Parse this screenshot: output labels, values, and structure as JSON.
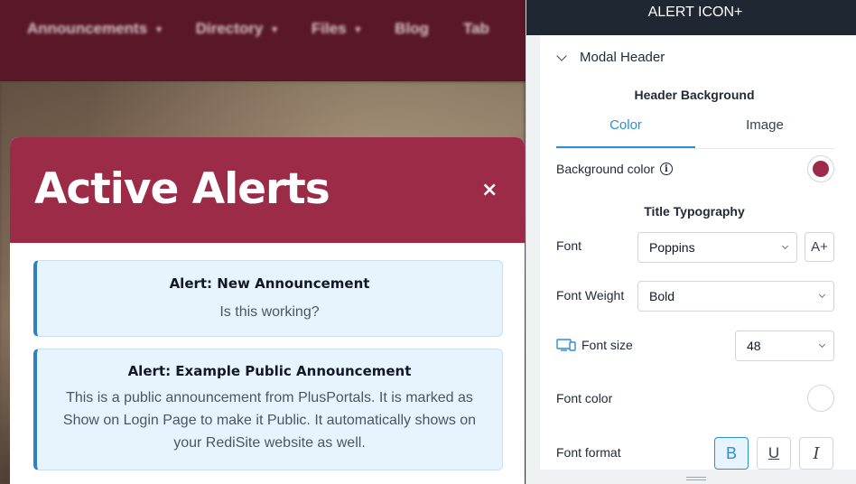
{
  "site": {
    "nav": [
      "Announcements",
      "Directory",
      "Files",
      "Blog",
      "Tab"
    ],
    "nav_has_caret": [
      true,
      true,
      true,
      false,
      false
    ]
  },
  "modal": {
    "title": "Active Alerts",
    "close_symbol": "×",
    "header_color": "#9b2b47",
    "alerts": [
      {
        "title": "Alert: New Announcement",
        "body": "Is this working?"
      },
      {
        "title": "Alert: Example Public Announcement",
        "body": "This is a public announcement from PlusPortals. It is marked as Show on Login Page to make it Public. It automatically shows on your RediSite website as well."
      }
    ]
  },
  "panel": {
    "top_title": "ALERT ICON+",
    "section": "Modal Header",
    "header_background_title": "Header Background",
    "tabs": [
      {
        "label": "Color",
        "active": true
      },
      {
        "label": "Image",
        "active": false
      }
    ],
    "background_color_label": "Background color",
    "background_color_value": "#9b2b47",
    "title_typography_title": "Title Typography",
    "font_label": "Font",
    "font_value": "Poppins",
    "font_button_label": "A+",
    "font_weight_label": "Font Weight",
    "font_weight_value": "Bold",
    "font_size_label": "Font size",
    "font_size_value": "48",
    "font_color_label": "Font color",
    "font_color_value": "#ffffff",
    "font_format_label": "Font format",
    "format_buttons": [
      {
        "label": "B",
        "active": true
      },
      {
        "label": "U",
        "active": false
      },
      {
        "label": "I",
        "active": false
      }
    ]
  }
}
